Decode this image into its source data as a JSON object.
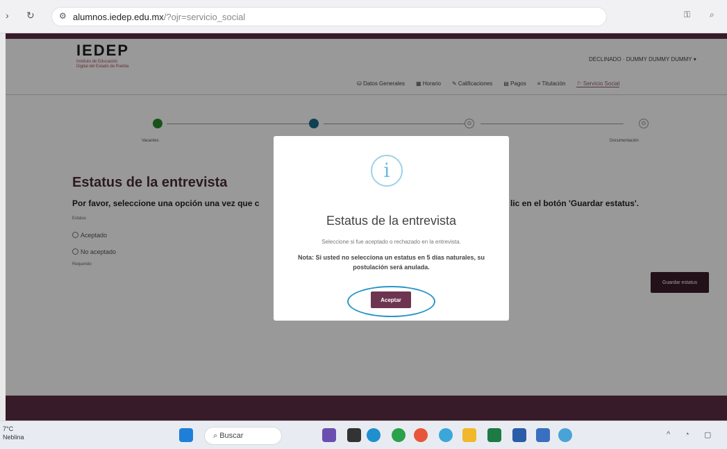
{
  "browser": {
    "url_domain": "alumnos.iedep.edu.mx",
    "url_path": "/?ojr=servicio_social"
  },
  "header": {
    "logo_text": "IEDEP",
    "logo_sub1": "Instituto de Educación",
    "logo_sub2": "Digital del Estado de Puebla",
    "user_label": "DECLINADO · DUMMY DUMMY DUMMY"
  },
  "nav": {
    "items": [
      "Datos Generales",
      "Horario",
      "Calificaciones",
      "Pagos",
      "Titulación",
      "Servicio Social"
    ]
  },
  "stepper": {
    "step1_label": "Vacantes",
    "step4_label": "Documentación",
    "pending_icon": "⊙"
  },
  "main": {
    "heading": "Estatus de la entrevista",
    "instruction_left": "Por favor, seleccione una opción una vez que c",
    "instruction_right": "lic en el botón 'Guardar estatus'.",
    "field_label": "Estatus",
    "option_accepted": "Aceptado",
    "option_not_accepted": "No aceptado",
    "required_note": "Requerido",
    "save_button": "Guardar estatus"
  },
  "modal": {
    "icon_glyph": "i",
    "title": "Estatus de la entrevista",
    "text": "Seleccione si fue aceptado o rechazado en la entrevista.",
    "note": "Nota: Si usted no selecciona un estatus en 5 días naturales, su postulación será anulada.",
    "accept_button": "Aceptar"
  },
  "taskbar": {
    "temp": "7°C",
    "weather_text": "Neblina",
    "search_placeholder": "Buscar"
  },
  "colors": {
    "brand": "#5e2e44",
    "accept": "#6d3550",
    "info": "#6fb9de",
    "highlight": "#2a95c8"
  }
}
